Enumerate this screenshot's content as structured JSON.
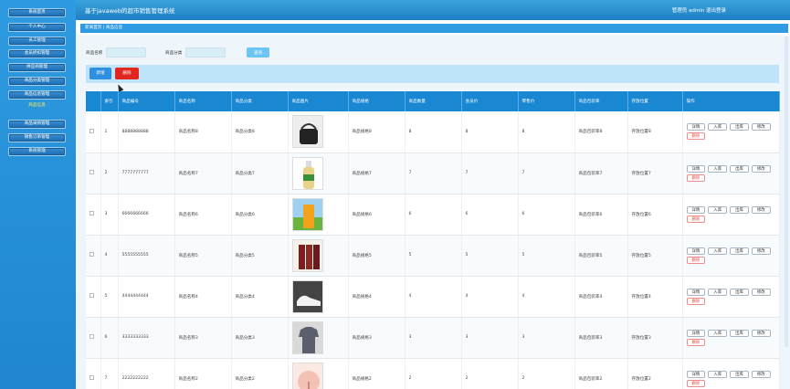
{
  "app": {
    "title": "基于javaweb的超市销售管理系统",
    "user": "管理员 admin  退出登录"
  },
  "sidebar": {
    "items": [
      {
        "label": "系统首页"
      },
      {
        "label": "个人中心"
      },
      {
        "label": "员工管理"
      },
      {
        "label": "会员折扣管理"
      },
      {
        "label": "供应商管理"
      },
      {
        "label": "商品分类管理"
      },
      {
        "label": "商品信息管理"
      }
    ],
    "sub": "商品信息",
    "items2": [
      {
        "label": "商品采购管理"
      },
      {
        "label": "销售订单管理"
      },
      {
        "label": "系统管理"
      }
    ]
  },
  "breadcrumb": "新闻首页  |  商品信息",
  "search": {
    "name_label": "商品名称",
    "name_value": "",
    "cat_label": "商品分类",
    "cat_value": "",
    "btn": "查询"
  },
  "actions": {
    "add": "新增",
    "del": "删除"
  },
  "table": {
    "headers": [
      "",
      "索引",
      "商品编号",
      "商品名称",
      "商品分类",
      "商品图片",
      "商品规格",
      "商品数量",
      "会员价",
      "零售价",
      "商品包装率",
      "存放位置",
      "操作"
    ],
    "rows": [
      {
        "idx": "1",
        "code": "8888888888",
        "name": "商品名称8",
        "cat": "商品分类8",
        "spec": "商品规格8",
        "qty": "8",
        "vip": "8",
        "retail": "8",
        "pack": "商品包装率8",
        "loc": "存放位置8",
        "img": "bag"
      },
      {
        "idx": "2",
        "code": "7777777777",
        "name": "商品名称7",
        "cat": "商品分类7",
        "spec": "商品规格7",
        "qty": "7",
        "vip": "7",
        "retail": "7",
        "pack": "商品包装率7",
        "loc": "存放位置7",
        "img": "bottle"
      },
      {
        "idx": "3",
        "code": "6666666666",
        "name": "商品名称6",
        "cat": "商品分类6",
        "spec": "商品规格6",
        "qty": "6",
        "vip": "6",
        "retail": "6",
        "pack": "商品包装率6",
        "loc": "存放位置6",
        "img": "juice"
      },
      {
        "idx": "4",
        "code": "5555555555",
        "name": "商品名称5",
        "cat": "商品分类5",
        "spec": "商品规格5",
        "qty": "5",
        "vip": "5",
        "retail": "5",
        "pack": "商品包装率5",
        "loc": "存放位置5",
        "img": "books"
      },
      {
        "idx": "5",
        "code": "4444444444",
        "name": "商品名称4",
        "cat": "商品分类4",
        "spec": "商品规格4",
        "qty": "4",
        "vip": "4",
        "retail": "4",
        "pack": "商品包装率4",
        "loc": "存放位置4",
        "img": "shoes"
      },
      {
        "idx": "6",
        "code": "3333333333",
        "name": "商品名称3",
        "cat": "商品分类3",
        "spec": "商品规格3",
        "qty": "3",
        "vip": "3",
        "retail": "3",
        "pack": "商品包装率3",
        "loc": "存放位置3",
        "img": "shirt"
      },
      {
        "idx": "7",
        "code": "2222222222",
        "name": "商品名称2",
        "cat": "商品分类2",
        "spec": "商品规格2",
        "qty": "2",
        "vip": "2",
        "retail": "2",
        "pack": "商品包装率2",
        "loc": "存放位置2",
        "img": "fan"
      }
    ],
    "ops": {
      "detail": "详情",
      "in": "入库",
      "out": "出库",
      "edit": "修改",
      "del": "删除"
    }
  },
  "colors": {
    "header": "#1987d2",
    "sidebar": "#2e9be0",
    "danger": "#e0261f",
    "primary": "#2f8fe0"
  }
}
